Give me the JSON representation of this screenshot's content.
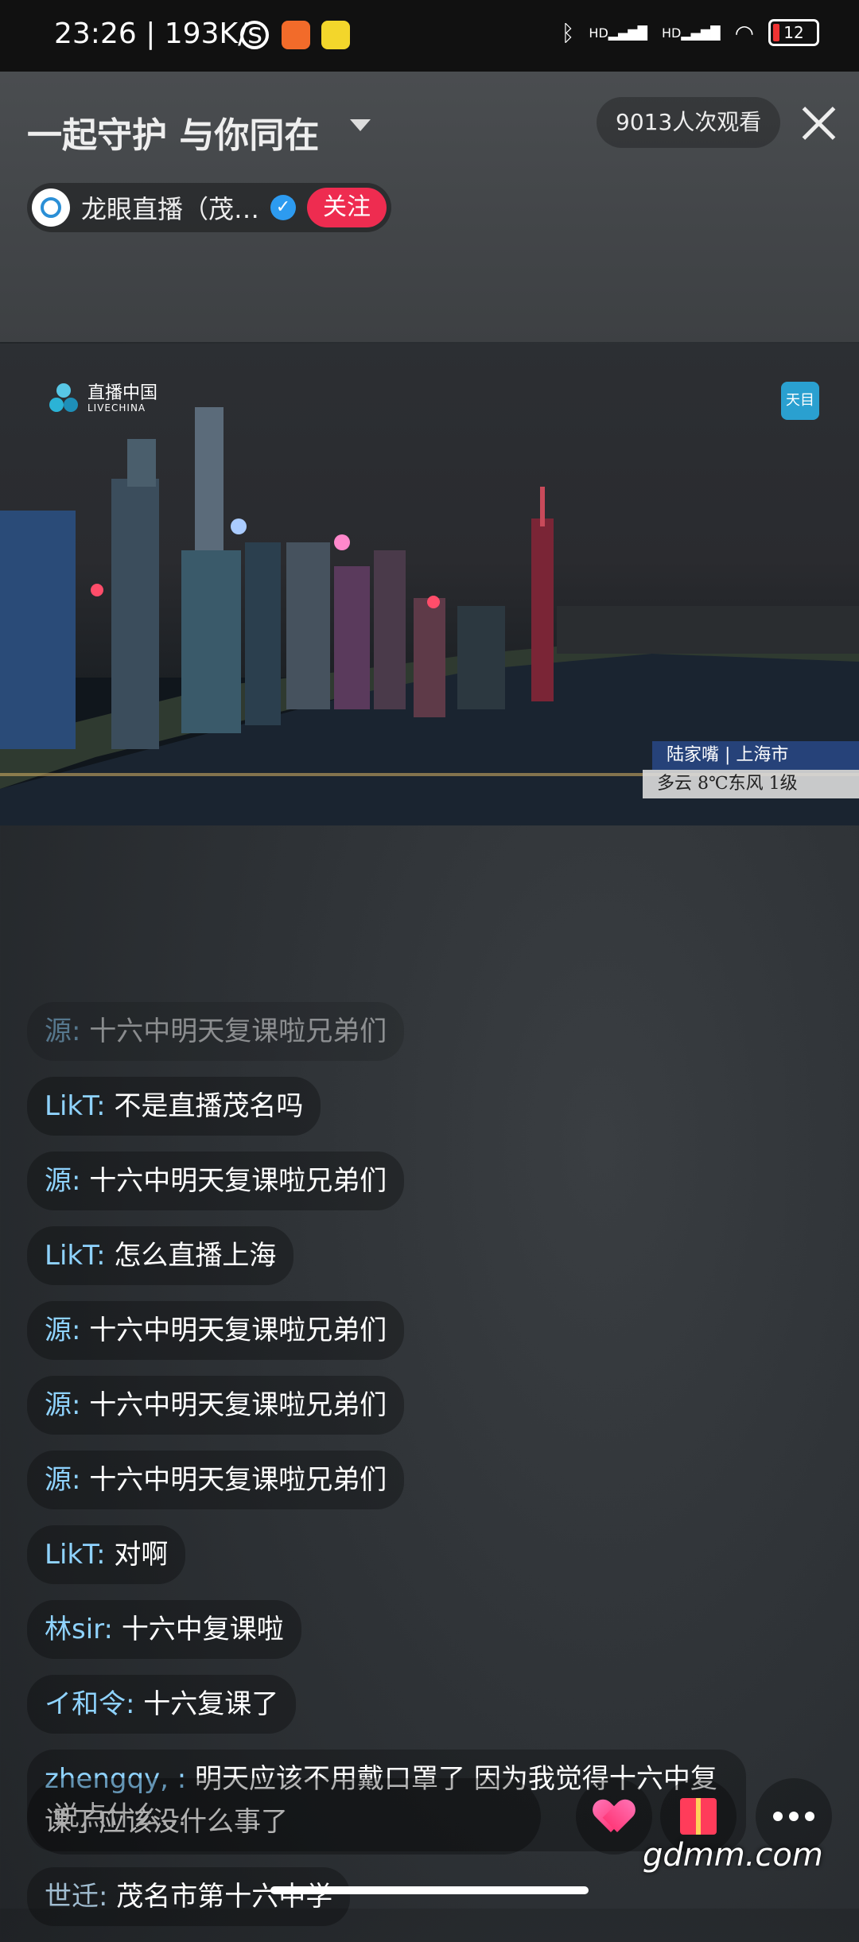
{
  "status_bar": {
    "time_speed": "23:26 | 193K/s",
    "signal_left": "HD",
    "signal_right": "HD",
    "battery": "12"
  },
  "header": {
    "title": "一起守护 与你同在",
    "viewers": "9013人次观看",
    "anchor_name": "龙眼直播（茂…",
    "follow_label": "关注"
  },
  "video": {
    "logo_text": "直播中国",
    "logo_sub": "LIVECHINA",
    "badge": "天目",
    "location": "陆家嘴 | 上海市",
    "weather": "多云 8℃东风 1级"
  },
  "chat": [
    {
      "user": "源:",
      "text": "十六中明天复课啦兄弟们",
      "faded": true
    },
    {
      "user": "LikT:",
      "text": "不是直播茂名吗"
    },
    {
      "user": "源:",
      "text": "十六中明天复课啦兄弟们"
    },
    {
      "user": "LikT:",
      "text": "怎么直播上海"
    },
    {
      "user": "源:",
      "text": "十六中明天复课啦兄弟们"
    },
    {
      "user": "源:",
      "text": "十六中明天复课啦兄弟们"
    },
    {
      "user": "源:",
      "text": "十六中明天复课啦兄弟们"
    },
    {
      "user": "LikT:",
      "text": "对啊"
    },
    {
      "user": "林sir:",
      "text": "十六中复课啦"
    },
    {
      "user": "イ和令:",
      "text": "十六复课了"
    },
    {
      "user": "zhengqy, :",
      "text": "明天应该不用戴口罩了 因为我觉得十六中复课了应该没什么事了"
    },
    {
      "user": "世迁:",
      "text": "茂名市第十六中学",
      "dim": true
    }
  ],
  "input": {
    "placeholder": "说点什么..."
  },
  "watermark": "gdmm.com",
  "colors": {
    "follow": "#ee2c50",
    "username": "#8fd3ff"
  }
}
